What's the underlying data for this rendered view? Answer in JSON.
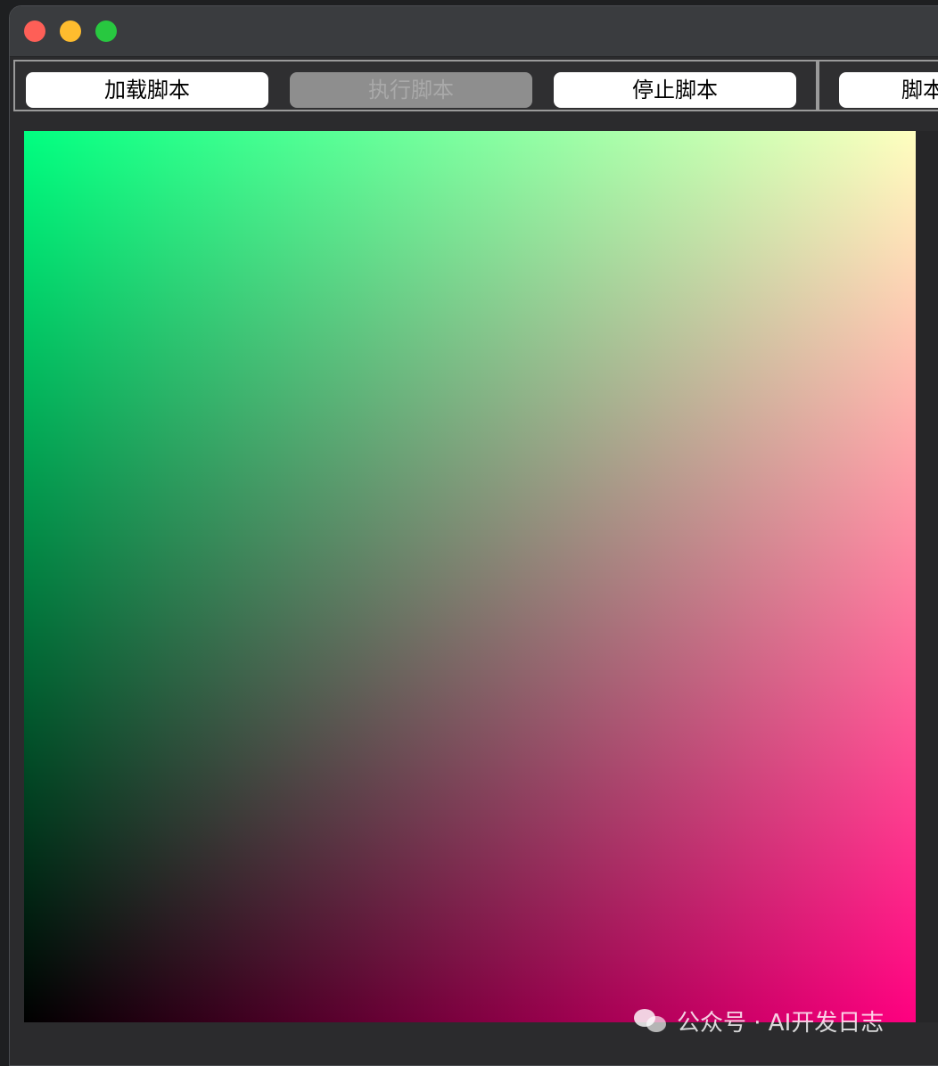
{
  "window": {
    "controls": {
      "close_color": "#fe5f57",
      "minimize_color": "#febc2e",
      "maximize_color": "#28c840"
    }
  },
  "toolbar": {
    "load_label": "加载脚本",
    "execute_label": "执行脚本",
    "execute_enabled": false,
    "stop_label": "停止脚本",
    "cut_label": "脚本"
  },
  "canvas": {
    "gradient": {
      "top_left": "#00ff80",
      "top_right": "#ffffff",
      "bottom_left": "#000000",
      "bottom_right": "#ff0080"
    }
  },
  "watermark": {
    "icon": "wechat-icon",
    "text": "公众号 · AI开发日志"
  }
}
